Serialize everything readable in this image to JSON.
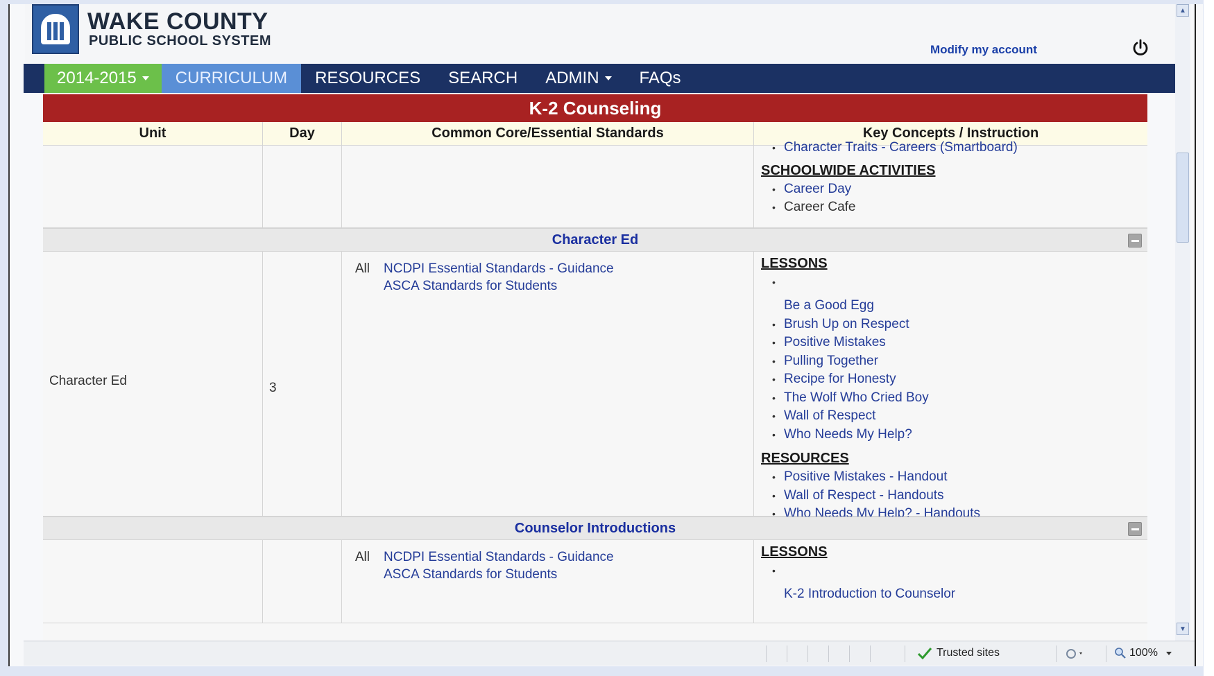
{
  "header": {
    "brand_line1": "WAKE COUNTY",
    "brand_line2": "PUBLIC SCHOOL SYSTEM",
    "modify_account": "Modify my account"
  },
  "nav": {
    "year": "2014-2015",
    "curriculum": "CURRICULUM",
    "resources": "RESOURCES",
    "search": "SEARCH",
    "admin": "ADMIN",
    "faqs": "FAQs"
  },
  "page": {
    "title": "K-2 Counseling"
  },
  "table": {
    "headers": [
      "Unit",
      "Day",
      "Common Core/Essential Standards",
      "Key Concepts / Instruction"
    ],
    "top_partial": {
      "partial_link": "Character Traits - Careers (Smartboard)",
      "schoolwide_title": "SCHOOLWIDE ACTIVITIES",
      "schoolwide_items": [
        "Career Day",
        "Career Cafe"
      ]
    },
    "groups": [
      {
        "name": "Character Ed",
        "unit": "Character Ed",
        "day": "3",
        "grade": "All",
        "standards": [
          "NCDPI Essential Standards - Guidance",
          "ASCA Standards for Students"
        ],
        "lessons_title": "LESSONS",
        "lessons": [
          "Be a Good Egg",
          "Brush Up on Respect",
          "Positive Mistakes",
          "Pulling Together",
          "Recipe for Honesty",
          "The Wolf Who Cried Boy",
          "Wall of Respect",
          "Who Needs My Help?"
        ],
        "resources_title": "RESOURCES",
        "resources": [
          "Positive Mistakes - Handout",
          "Wall of Respect - Handouts",
          "Who Needs My Help? - Handouts"
        ]
      },
      {
        "name": "Counselor Introductions",
        "unit": "",
        "day": "",
        "grade": "All",
        "standards": [
          "NCDPI Essential Standards - Guidance",
          "ASCA Standards for Students"
        ],
        "lessons_title": "LESSONS",
        "lessons": [
          "K-2 Introduction to Counselor"
        ]
      }
    ]
  },
  "statusbar": {
    "trusted": "Trusted sites",
    "zoom": "100%"
  },
  "icons": {
    "power": "power-icon",
    "collapse": "minus-square-icon",
    "check": "checkmark-icon",
    "zoom": "magnifier-icon"
  },
  "colors": {
    "navbar": "#1b3163",
    "year_tab": "#6cc04a",
    "active_tab": "#5a8fd6",
    "title_bar": "#a82222",
    "link": "#243c98"
  }
}
